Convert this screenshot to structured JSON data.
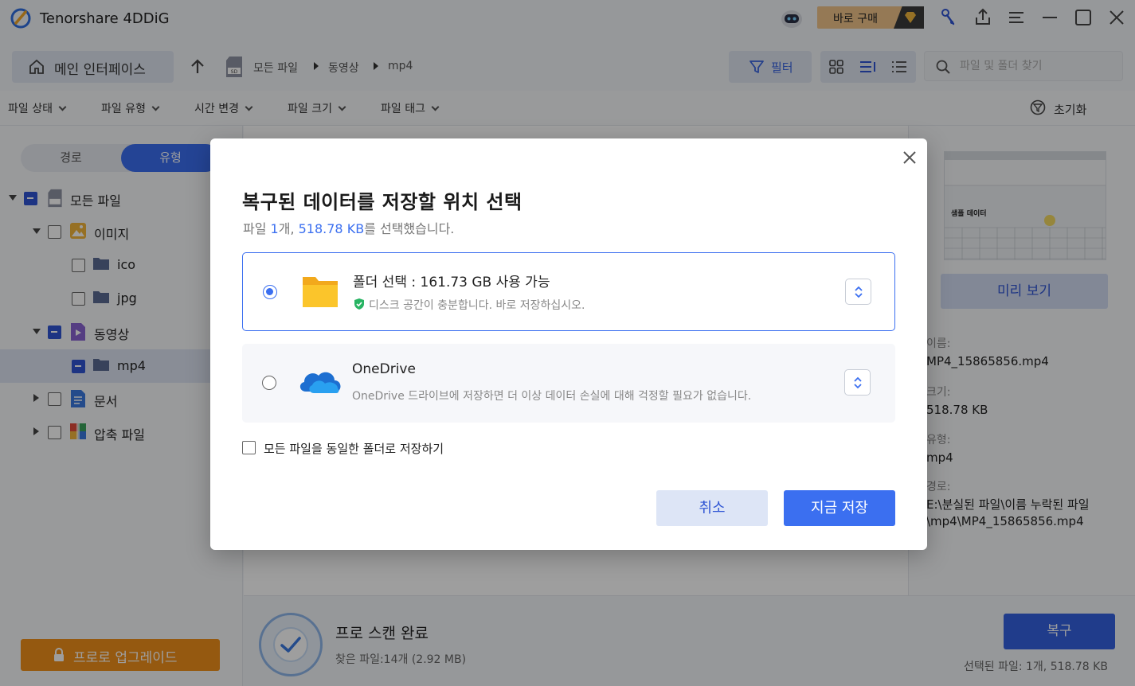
{
  "app": {
    "title": "Tenorshare 4DDiG",
    "buy_label": "바로 구매"
  },
  "toolbar": {
    "home_label": "메인 인터페이스",
    "breadcrumb": [
      "모든 파일",
      "동영상",
      "mp4"
    ],
    "filter_label": "필터",
    "search_placeholder": "파일 및 폴더 찾기"
  },
  "filters": {
    "items": [
      "파일 상태",
      "파일 유형",
      "시간 변경",
      "파일 크기",
      "파일 태그"
    ],
    "reset_label": "초기화"
  },
  "sidebar": {
    "tabs": [
      "경로",
      "유형"
    ],
    "active_tab": "유형",
    "tree": [
      {
        "label": "모든 파일",
        "state": "partial"
      },
      {
        "label": "이미지",
        "state": "unchecked"
      },
      {
        "label": "ico",
        "state": "unchecked"
      },
      {
        "label": "jpg",
        "state": "unchecked"
      },
      {
        "label": "동영상",
        "state": "partial"
      },
      {
        "label": "mp4",
        "state": "partial",
        "selected": true
      },
      {
        "label": "문서",
        "state": "unchecked"
      },
      {
        "label": "압축 파일",
        "state": "unchecked"
      }
    ],
    "upgrade_label": "프로로 업그레이드"
  },
  "preview": {
    "thumb_text": "샘플 데이터",
    "button_label": "미리 보기",
    "name_key": "이름:",
    "name_value": "MP4_15865856.mp4",
    "size_key": "크기:",
    "size_value": "518.78 KB",
    "type_key": "유형:",
    "type_value": "mp4",
    "path_key": "경로:",
    "path_value_1": "E:\\분실된 파일\\이름 누락된 파일",
    "path_value_2": "\\mp4\\MP4_15865856.mp4"
  },
  "status": {
    "title": "프로 스캔 완료",
    "found": "찾은 파일:14개 (2.92 MB)",
    "recover_label": "복구",
    "selected_info": "선택된 파일: 1개, 518.78 KB"
  },
  "dialog": {
    "title": "복구된 데이터를 저장할 위치 선택",
    "subtitle_prefix": "파일 ",
    "subtitle_count": "1",
    "subtitle_mid": "개, ",
    "subtitle_size": "518.78 KB",
    "subtitle_suffix": "를 선택했습니다.",
    "option_folder": {
      "title": "폴더 선택  : 161.73 GB 사용 가능",
      "desc": "디스크 공간이 충분합니다. 바로 저장하십시오.",
      "selected": true
    },
    "option_onedrive": {
      "title": "OneDrive",
      "desc": "OneDrive 드라이브에 저장하면 더 이상 데이터 손실에 대해 걱정할 필요가 없습니다.",
      "selected": false
    },
    "same_folder_label": "모든 파일을 동일한 폴더로 저장하기",
    "cancel_label": "취소",
    "save_label": "지금 저장"
  },
  "colors": {
    "accent": "#3b6ff0",
    "upgrade": "#f0901a",
    "buy": "#f0c48a"
  }
}
